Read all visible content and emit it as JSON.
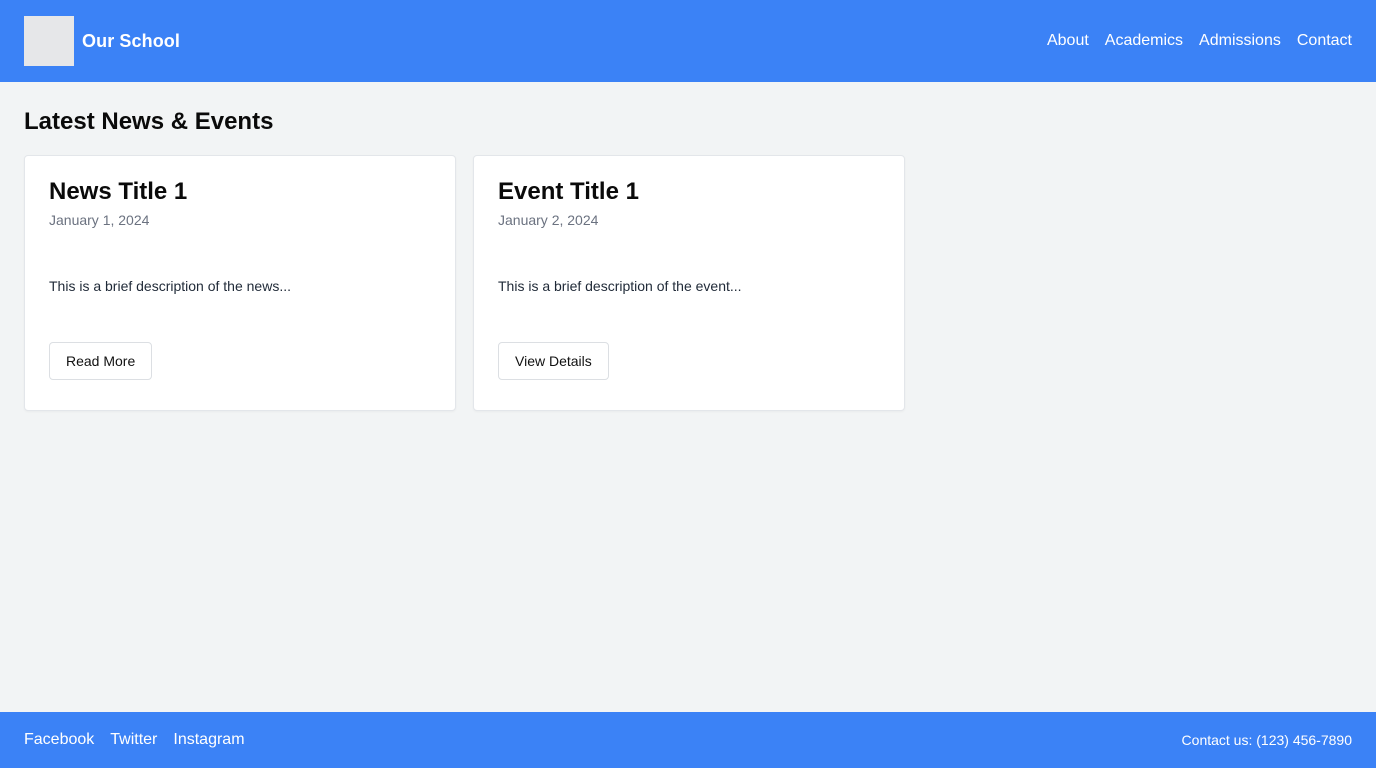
{
  "header": {
    "logo_icon": "school-logo-placeholder",
    "title": "Our School",
    "nav": [
      {
        "label": "About"
      },
      {
        "label": "Academics"
      },
      {
        "label": "Admissions"
      },
      {
        "label": "Contact"
      }
    ]
  },
  "main": {
    "section_title": "Latest News & Events",
    "cards": [
      {
        "title": "News Title 1",
        "date": "January 1, 2024",
        "description": "This is a brief description of the news...",
        "button_label": "Read More"
      },
      {
        "title": "Event Title 1",
        "date": "January 2, 2024",
        "description": "This is a brief description of the event...",
        "button_label": "View Details"
      }
    ]
  },
  "footer": {
    "social": [
      {
        "label": "Facebook"
      },
      {
        "label": "Twitter"
      },
      {
        "label": "Instagram"
      }
    ],
    "contact": "Contact us: (123) 456-7890"
  },
  "colors": {
    "brand": "#3b82f6",
    "background": "#f2f4f5",
    "card": "#ffffff",
    "muted_text": "#6b7280"
  }
}
